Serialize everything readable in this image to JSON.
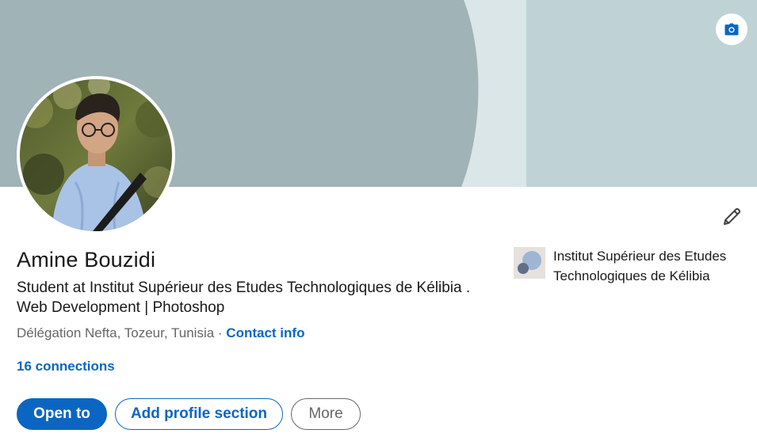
{
  "profile": {
    "name": "Amine Bouzidi",
    "headline": "Student at Institut Supérieur des Etudes Technologiques de Kélibia . Web Development | Photoshop",
    "location": "Délégation Nefta, Tozeur, Tunisia",
    "separator": " · ",
    "contact_info_label": "Contact info",
    "connections_label": "16 connections"
  },
  "education": {
    "school_name": "Institut Supérieur des Etudes Technologiques de Kélibia"
  },
  "actions": {
    "open_to_label": "Open to",
    "add_section_label": "Add profile section",
    "more_label": "More"
  },
  "icons": {
    "cover_edit": "camera-icon",
    "intro_edit": "pencil-icon"
  },
  "colors": {
    "accent": "#0a66c2",
    "cover_dark": "#a0b3b6",
    "cover_light": "#bfd3d7",
    "text_primary": "#191919",
    "text_secondary": "#666666"
  }
}
